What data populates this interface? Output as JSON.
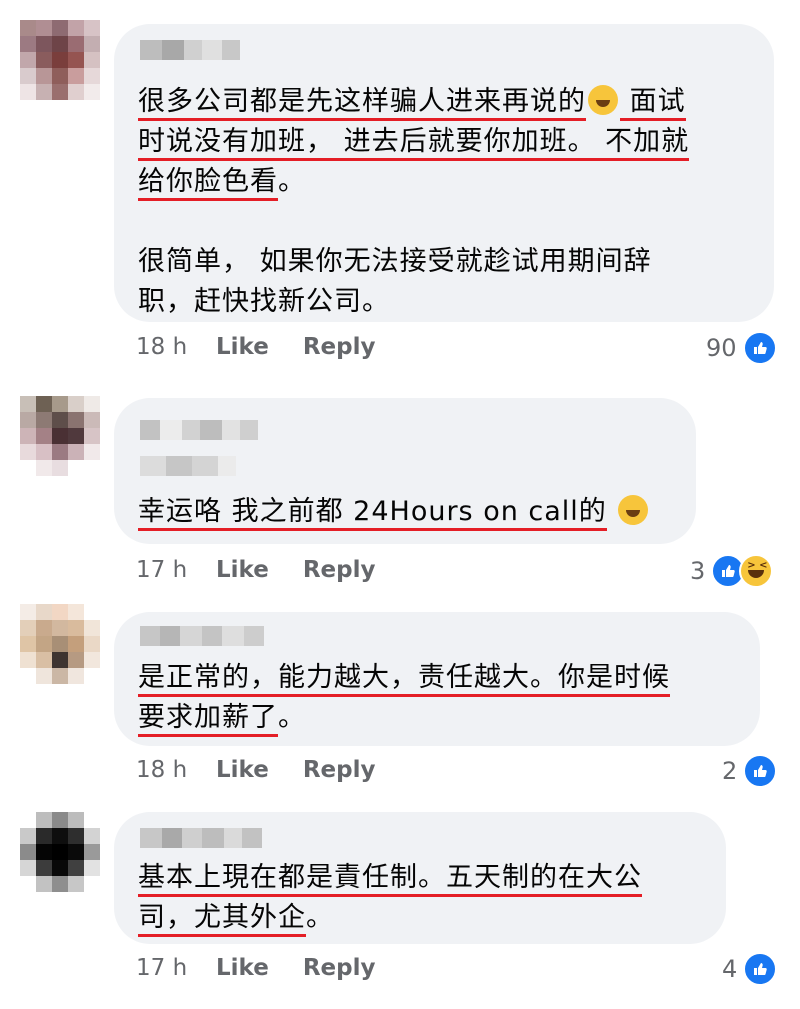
{
  "comments": [
    {
      "lines_p1": [
        {
          "text": "很多公司都是先这样骗人进来再说的",
          "underline": true
        },
        {
          "text": "时说没有加班， 进去后就要你加班。 不加就",
          "underline": true
        },
        {
          "text": "给你脸色看",
          "underline": true,
          "tail": "。"
        }
      ],
      "after_emoji": " 面试",
      "paragraph2": [
        "很简单， 如果你无法接受就趁试用期间辞",
        "职，赶快找新公司。"
      ],
      "time": "18 h",
      "like_label": "Like",
      "reply_label": "Reply",
      "reaction_count": "90",
      "reactions": [
        "like-icon"
      ]
    },
    {
      "lines": [
        {
          "text": "幸运咯 我之前都 24Hours on call的",
          "underline": true
        }
      ],
      "time": "17 h",
      "like_label": "Like",
      "reply_label": "Reply",
      "reaction_count": "3",
      "reactions": [
        "like-icon",
        "haha-icon"
      ]
    },
    {
      "lines": [
        {
          "text": "是正常的，能力越大，责任越大。你是时候",
          "underline": true
        },
        {
          "text": "要求加薪了",
          "underline": true,
          "tail": "。"
        }
      ],
      "time": "18 h",
      "like_label": "Like",
      "reply_label": "Reply",
      "reaction_count": "2",
      "reactions": [
        "like-icon"
      ]
    },
    {
      "lines": [
        {
          "text": "基本上現在都是責任制。五天制的在大公",
          "underline": true
        },
        {
          "text": "司，尤其外企",
          "underline": true,
          "tail": "。"
        }
      ],
      "time": "17 h",
      "like_label": "Like",
      "reply_label": "Reply",
      "reaction_count": "4",
      "reactions": [
        "like-icon"
      ]
    }
  ],
  "colors": {
    "bubble": "#f0f2f5",
    "underline": "#e41e26",
    "like_blue": "#1877f2",
    "meta_text": "#65676b"
  }
}
